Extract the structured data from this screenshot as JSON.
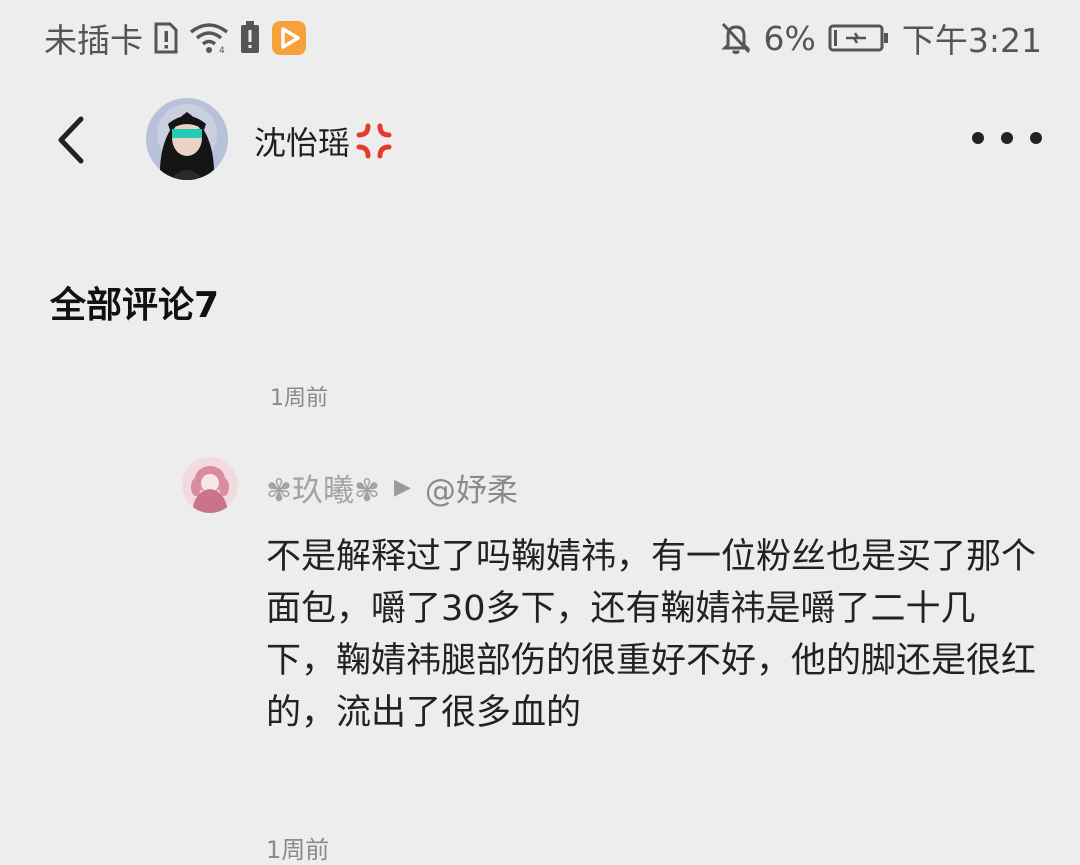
{
  "status_bar": {
    "carrier": "未插卡",
    "notification_off_icon": "bell-off-icon",
    "battery_percent": "6%",
    "time": "下午3:21"
  },
  "header": {
    "back_icon": "chevron-left-icon",
    "user_name": "沈怡瑶",
    "name_emoji": "💢",
    "more_icon": "more-horizontal-icon"
  },
  "comments": {
    "title": "全部评论7",
    "prev_time": "1周前",
    "reply": {
      "author": "✾玖曦✾",
      "arrow": "▶",
      "reply_to": "@妤柔",
      "text": "不是解释过了吗鞠婧祎，有一位粉丝也是买了那个面包，嚼了30多下，还有鞠婧祎是嚼了二十几下，鞠婧祎腿部伤的很重好不好，他的脚还是很红的，流出了很多血的",
      "time": "1周前"
    }
  },
  "colors": {
    "background": "#ededed",
    "accent_orange": "#f7a13a"
  }
}
